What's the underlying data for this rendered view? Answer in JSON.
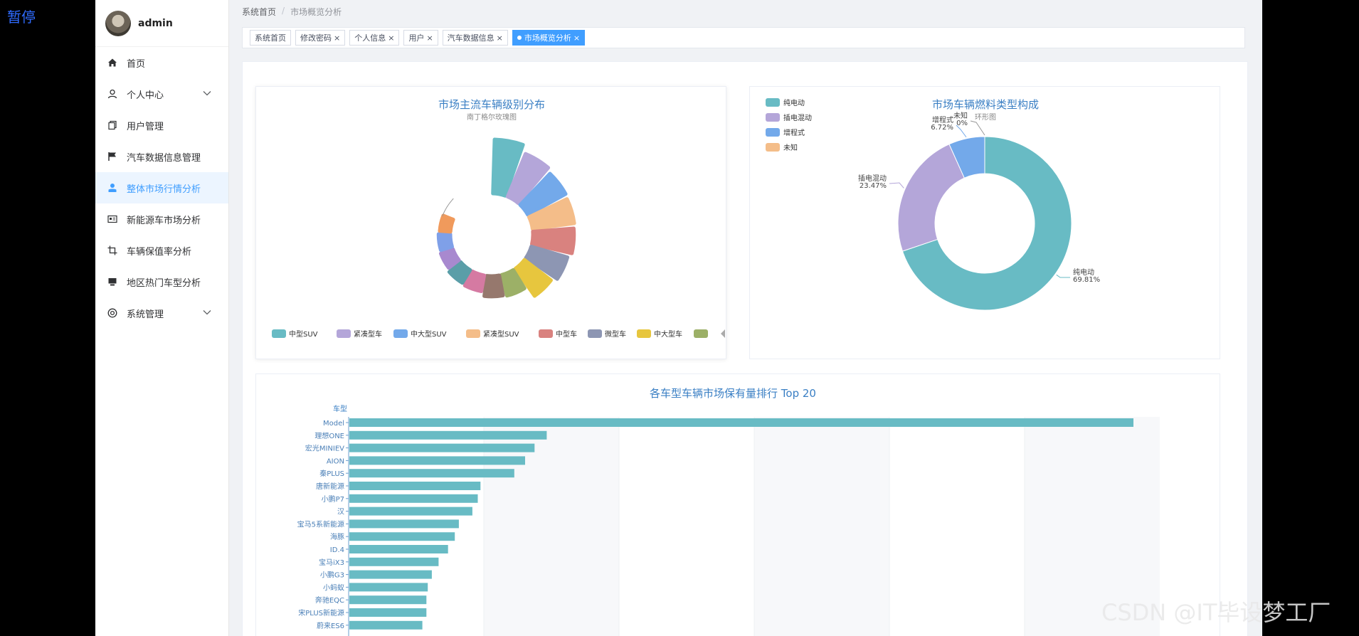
{
  "overlay": {
    "paused_text": "暂停"
  },
  "watermark": "CSDN @IT毕设梦工厂",
  "user": {
    "name": "admin"
  },
  "sidebar": {
    "items": [
      {
        "label": "首页",
        "icon": "home-icon"
      },
      {
        "label": "个人中心",
        "icon": "user-icon",
        "expandable": true
      },
      {
        "label": "用户管理",
        "icon": "copy-icon"
      },
      {
        "label": "汽车数据信息管理",
        "icon": "flag-icon"
      },
      {
        "label": "整体市场行情分析",
        "icon": "person-icon",
        "active": true
      },
      {
        "label": "新能源车市场分析",
        "icon": "id-card-icon"
      },
      {
        "label": "车辆保值率分析",
        "icon": "crop-icon"
      },
      {
        "label": "地区热门车型分析",
        "icon": "monitor-icon"
      },
      {
        "label": "系统管理",
        "icon": "settings-icon",
        "expandable": true
      }
    ]
  },
  "breadcrumb": {
    "home": "系统首页",
    "separator": "/",
    "current": "市场概览分析"
  },
  "tabs": [
    {
      "label": "系统首页",
      "closable": false
    },
    {
      "label": "修改密码",
      "closable": true
    },
    {
      "label": "个人信息",
      "closable": true
    },
    {
      "label": "用户",
      "closable": true
    },
    {
      "label": "汽车数据信息",
      "closable": true
    },
    {
      "label": "市场概览分析",
      "closable": true,
      "active": true
    }
  ],
  "colors": {
    "accent": "#409eff",
    "chart_title": "#3a7fc4",
    "palette": [
      "#68bbc4",
      "#b4a6d9",
      "#73a9ea",
      "#f4bd89",
      "#d9827f",
      "#8d96b3",
      "#e7c63e",
      "#9cb067",
      "#96786d",
      "#d57aa2",
      "#5a9ea8",
      "#a889cf",
      "#7fa0e8",
      "#f09a5c"
    ]
  },
  "chart_data": [
    {
      "type": "pie",
      "variant": "nightingale-rose",
      "title": "市场主流车辆级别分布",
      "subtitle": "南丁格尔玫瑰图",
      "categories": [
        "中型SUV",
        "紧凑型车",
        "中大型SUV",
        "紧凑型SUV",
        "中型车",
        "微型车",
        "中大型车"
      ],
      "values": [
        100,
        86,
        80,
        78,
        76,
        70,
        62,
        40,
        38,
        30,
        28,
        24,
        22,
        20
      ],
      "legend_position": "bottom",
      "legend_page": "1/3"
    },
    {
      "type": "pie",
      "variant": "donut",
      "title": "市场车辆燃料类型构成",
      "subtitle": "环形图",
      "categories": [
        "纯电动",
        "插电混动",
        "增程式",
        "未知"
      ],
      "values": [
        69.81,
        23.47,
        6.72,
        0
      ],
      "data_labels": [
        "纯电动\n69.81%",
        "插电混动\n23.47%",
        "增程式\n6.72%",
        "未知\n0%"
      ],
      "legend_position": "top-left"
    },
    {
      "type": "bar",
      "orientation": "horizontal",
      "title": "各车型车辆市场保有量排行 Top 20",
      "ylabel": "车型",
      "categories": [
        "Model",
        "理想ONE",
        "宏光MINIEV",
        "AION",
        "秦PLUS",
        "唐新能源",
        "小鹏P7",
        "汉",
        "宝马5系新能源",
        "海豚",
        "ID.4",
        "宝马iX3",
        "小鹏G3",
        "小蚂蚁",
        "奔驰EQC",
        "宋PLUS新能源",
        "蔚来ES6"
      ],
      "values": [
        5800,
        1460,
        1370,
        1300,
        1220,
        970,
        950,
        910,
        810,
        780,
        730,
        660,
        610,
        580,
        570,
        570,
        540
      ],
      "xlim": [
        0,
        6000
      ],
      "grid": true
    }
  ]
}
